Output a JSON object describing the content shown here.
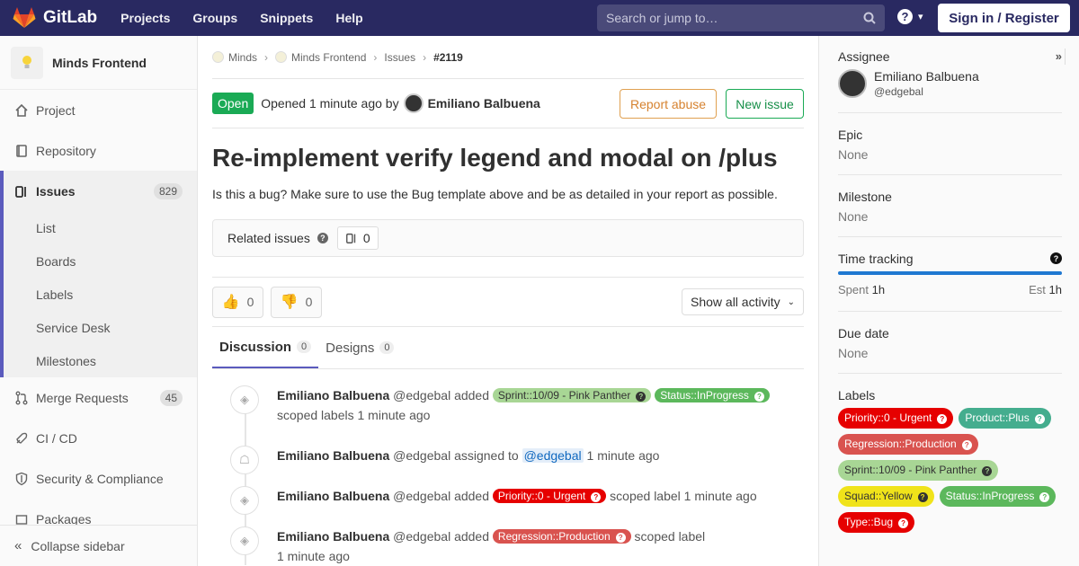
{
  "topbar": {
    "brand": "GitLab",
    "nav": [
      "Projects",
      "Groups",
      "Snippets",
      "Help"
    ],
    "search_placeholder": "Search or jump to…",
    "help_icon": "question-circle-icon",
    "sign_in": "Sign in / Register",
    "brand_color": "#292961"
  },
  "sidebar": {
    "project_name": "Minds Frontend",
    "items": [
      {
        "label": "Project",
        "icon": "home-icon"
      },
      {
        "label": "Repository",
        "icon": "book-icon"
      },
      {
        "label": "Issues",
        "icon": "issues-icon",
        "count": "829"
      },
      {
        "label": "Merge Requests",
        "icon": "merge-request-icon",
        "count": "45"
      },
      {
        "label": "CI / CD",
        "icon": "rocket-icon"
      },
      {
        "label": "Security & Compliance",
        "icon": "shield-icon"
      },
      {
        "label": "Packages",
        "icon": "package-icon"
      }
    ],
    "issue_subitems": [
      "List",
      "Boards",
      "Labels",
      "Service Desk",
      "Milestones"
    ],
    "collapse_label": "Collapse sidebar"
  },
  "breadcrumb": [
    "Minds",
    "Minds Frontend",
    "Issues",
    "#2119"
  ],
  "issue": {
    "status": "Open",
    "opened_text": "Opened 1 minute ago by",
    "author": "Emiliano Balbuena",
    "report_abuse": "Report abuse",
    "new_issue": "New issue",
    "title": "Re-implement verify legend and modal on /plus",
    "description": "Is this a bug? Make sure to use the Bug template above and be as detailed in your report as possible.",
    "related_label": "Related issues",
    "related_count": "0",
    "thumbs_up": "0",
    "thumbs_down": "0",
    "activity_filter": "Show all activity"
  },
  "tabs": [
    {
      "label": "Discussion",
      "count": "0"
    },
    {
      "label": "Designs",
      "count": "0"
    }
  ],
  "notes": {
    "n1": {
      "name": "Emiliano Balbuena",
      "handle": "@edgebal",
      "action": "added",
      "label_a": "Sprint::10/09 - Pink Panther",
      "label_b": "Status::InProgress",
      "tail": "scoped labels 1 minute ago"
    },
    "n2": {
      "name": "Emiliano Balbuena",
      "handle": "@edgebal",
      "action": "assigned to",
      "mention": "@edgebal",
      "tail": "1 minute ago"
    },
    "n3": {
      "name": "Emiliano Balbuena",
      "handle": "@edgebal",
      "action": "added",
      "label": "Priority::0 - Urgent",
      "tail": "scoped label 1 minute ago"
    },
    "n4": {
      "name": "Emiliano Balbuena",
      "handle": "@edgebal",
      "action": "added",
      "label": "Regression::Production",
      "tail": "scoped label",
      "tail2": "1 minute ago"
    }
  },
  "right_sidebar": {
    "assignee_title": "Assignee",
    "assignee_name": "Emiliano Balbuena",
    "assignee_handle": "@edgebal",
    "epic_title": "Epic",
    "epic_value": "None",
    "milestone_title": "Milestone",
    "milestone_value": "None",
    "time_title": "Time tracking",
    "spent_label": "Spent",
    "spent_value": "1h",
    "est_label": "Est",
    "est_value": "1h",
    "time_progress": 1.0,
    "due_title": "Due date",
    "due_value": "None",
    "labels_title": "Labels",
    "labels": [
      {
        "text": "Priority::0 - Urgent",
        "color": "#e60000"
      },
      {
        "text": "Product::Plus",
        "color": "#44ad8e"
      },
      {
        "text": "Regression::Production",
        "color": "#d9534f"
      },
      {
        "text": "Sprint::10/09 - Pink Panther",
        "color": "#a8d695"
      },
      {
        "text": "Squad::Yellow",
        "color": "#f0e31a"
      },
      {
        "text": "Status::InProgress",
        "color": "#5cb85c"
      },
      {
        "text": "Type::Bug",
        "color": "#e60000"
      }
    ]
  }
}
